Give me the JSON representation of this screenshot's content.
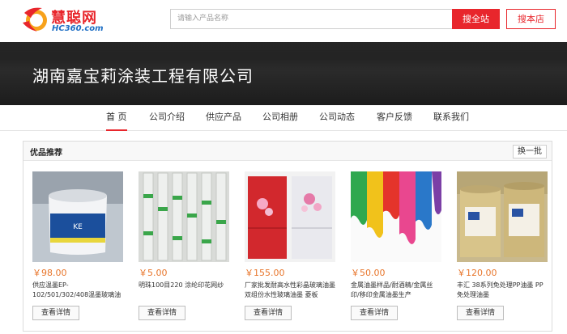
{
  "header": {
    "logo_main": "慧聪网",
    "logo_sub": "HC360.com",
    "search_placeholder": "请输入产品名称",
    "search_all_label": "搜全站",
    "search_store_label": "搜本店"
  },
  "banner": {
    "company_name": "湖南嘉宝莉涂装工程有限公司"
  },
  "nav": {
    "items": [
      "首 页",
      "公司介绍",
      "供应产品",
      "公司相册",
      "公司动态",
      "客户反馈",
      "联系我们"
    ],
    "active_index": 0
  },
  "panel": {
    "title": "优品推荐",
    "refresh_label": "换一批",
    "products": [
      {
        "price": "￥98.00",
        "name": "供应温墨EP-102/501/302/408温墨玻璃油",
        "button": "查看详情"
      },
      {
        "price": "￥5.00",
        "name": "明珠100目220 涂纶印花网纱",
        "button": "查看详情"
      },
      {
        "price": "￥155.00",
        "name": "厂家批发耐高水性彩晶玻璃油墨 双组份水性玻璃油墨 菱板",
        "button": "查看详情"
      },
      {
        "price": "￥50.00",
        "name": "金属油墨样品/耐酒精/金属丝印/移印金属油墨生产",
        "button": "查看详情"
      },
      {
        "price": "￥120.00",
        "name": "丰汇 38系列免处理PP油墨 PP免处理油墨",
        "button": "查看详情"
      }
    ]
  },
  "colors": {
    "brand_red": "#e8262c",
    "price_orange": "#e8762c",
    "logo_blue": "#1e6fc5"
  }
}
